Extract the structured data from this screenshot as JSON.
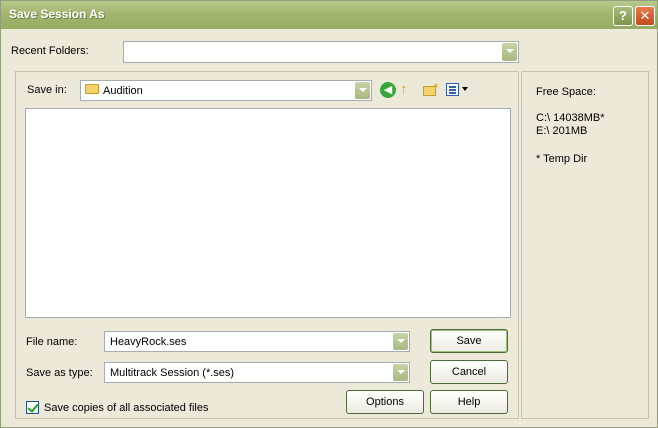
{
  "window": {
    "title": "Save Session As",
    "help_glyph": "?",
    "close_glyph": "✕"
  },
  "recent_folders": {
    "label": "Recent Folders:",
    "value": ""
  },
  "save_in": {
    "label": "Save in:",
    "folder": "Audition"
  },
  "nav_icons": [
    "back-icon",
    "up-folder-icon",
    "new-folder-icon",
    "view-menu-icon"
  ],
  "file_name": {
    "label": "File name:",
    "value": "HeavyRock.ses"
  },
  "save_as_type": {
    "label": "Save as type:",
    "value": "Multitrack Session (*.ses)"
  },
  "buttons": {
    "save": "Save",
    "cancel": "Cancel",
    "options": "Options",
    "help": "Help"
  },
  "save_copies": {
    "label": "Save copies of all associated files",
    "checked": true
  },
  "free_space": {
    "title": "Free Space:",
    "drives": [
      "C:\\  14038MB*",
      "E:\\  201MB"
    ],
    "note": "* Temp Dir"
  },
  "colors": {
    "titlebar": "#a2b56f",
    "window_bg": "#ece9d8",
    "check_green": "#21a121"
  }
}
